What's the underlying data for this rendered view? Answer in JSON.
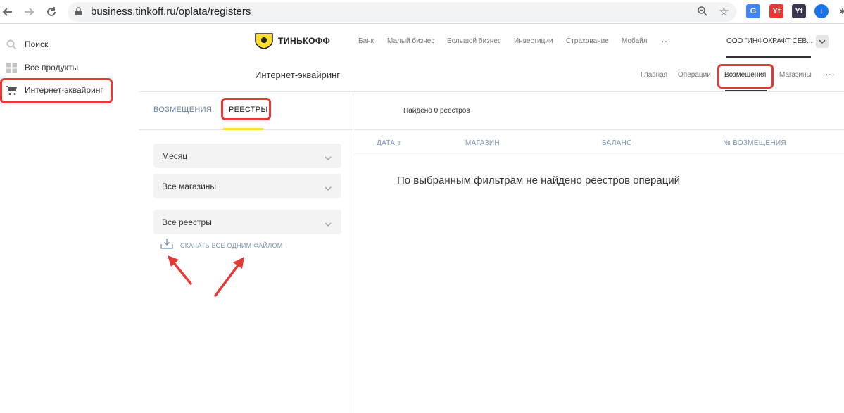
{
  "browser": {
    "url": "business.tinkoff.ru/oplata/registers",
    "extensions": [
      {
        "name": "translate",
        "label": "G",
        "color": "#4285f4"
      },
      {
        "name": "yt-red",
        "label": "Yt",
        "color": "#e53935"
      },
      {
        "name": "yt-dark",
        "label": "Yt",
        "color": "#3b3550"
      },
      {
        "name": "downloader",
        "label": "↓",
        "color": "#1a73e8"
      }
    ]
  },
  "sidebar": {
    "items": [
      {
        "label": "Поиск",
        "icon": "search-icon"
      },
      {
        "label": "Все продукты",
        "icon": "grid-icon"
      },
      {
        "label": "Интернет-эквайринг",
        "icon": "cart-icon"
      }
    ]
  },
  "topnav": {
    "logo": "ТИНЬКОФФ",
    "items": [
      "Банк",
      "Малый бизнес",
      "Большой бизнес",
      "Инвестиции",
      "Страхование",
      "Мобайл",
      "···"
    ],
    "company": "ООО \"ИНФОКРАФТ СЕВ..."
  },
  "subnav": {
    "title": "Интернет-эквайринг",
    "items": [
      "Главная",
      "Операции",
      "Возмещения",
      "Магазины",
      "···"
    ],
    "active": "Возмещения"
  },
  "filters": {
    "tabs": [
      "ВОЗМЕЩЕНИЯ",
      "РЕЕСТРЫ"
    ],
    "active_tab": "РЕЕСТРЫ",
    "selects": [
      {
        "value": "Месяц"
      },
      {
        "value": "Все магазины"
      },
      {
        "value": "Все реестры"
      }
    ],
    "download_label": "СКАЧАТЬ ВСЕ ОДНИМ ФАЙЛОМ"
  },
  "results": {
    "found_text": "Найдено 0 реестров",
    "columns": [
      "ДАТА",
      "МАГАЗИН",
      "БАЛАНС",
      "№ ВОЗМЕЩЕНИЯ"
    ],
    "empty_message": "По выбранным фильтрам не найдено реестров операций"
  },
  "colors": {
    "highlight": "#e53935",
    "accent_yellow": "#ffdd2d",
    "link_blue": "#7b96b5"
  }
}
